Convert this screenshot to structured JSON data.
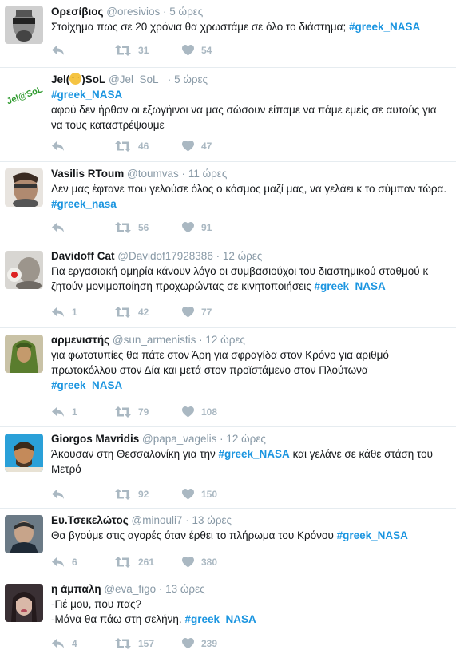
{
  "tweets": [
    {
      "name": "Ορεσίβιος",
      "handle": "@oresivios",
      "time": "5 ώρες",
      "text": "Στοίχημα πως σε 20 χρόνια θα χρωστάμε σε όλο το διάστημα;",
      "hashtag": "#greek_NASA",
      "replies": "",
      "retweets": "31",
      "likes": "54"
    },
    {
      "name_pre": "Jel(",
      "name_post": ")SoL",
      "handle": "@Jel_SoL_",
      "time": "5 ώρες",
      "hashtag": "#greek_NASA",
      "text": "αφού δεν ήρθαν οι εξωγήινοι να μας σώσουν είπαμε να πάμε εμείς σε αυτούς για να τους καταστρέψουμε",
      "avatar_text": "Jel@SoL",
      "replies": "",
      "retweets": "46",
      "likes": "47"
    },
    {
      "name": "Vasilis RToum",
      "handle": "@toumvas",
      "time": "11 ώρες",
      "text": "Δεν μας έφτανε που γελούσε όλος ο κόσμος μαζί μας, να γελάει κ το σύμπαν τώρα.",
      "hashtag": "#greek_nasa",
      "replies": "",
      "retweets": "56",
      "likes": "91"
    },
    {
      "name": "Davidoff Cat",
      "handle": "@Davidof17928386",
      "time": "12 ώρες",
      "text": "Για εργασιακή ομηρία κάνουν λόγο οι συμβασιούχοι του διαστημικού σταθμού κ ζητούν μονιμοποίηση προχωρώντας σε κινητοποιήσεις",
      "hashtag": "#greek_NASA",
      "replies": "1",
      "retweets": "42",
      "likes": "77"
    },
    {
      "name": "αρμενιστής",
      "handle": "@sun_armenistis",
      "time": "12 ώρες",
      "text": "για φωτοτυπίες θα πάτε στον Άρη για σφραγίδα στον Κρόνο για αριθμό πρωτοκόλλου στον Δία και μετά στον προϊστάμενο στον Πλούτωνα",
      "hashtag": "#greek_NASA",
      "replies": "1",
      "retweets": "79",
      "likes": "108"
    },
    {
      "name": "Giorgos Mavridis",
      "handle": "@papa_vagelis",
      "time": "12 ώρες",
      "text_pre": "Άκουσαν στη Θεσσαλονίκη για την",
      "hashtag": "#greek_NASA",
      "text_post": "και γελάνε σε κάθε στάση του Μετρό",
      "replies": "",
      "retweets": "92",
      "likes": "150"
    },
    {
      "name": "Ευ.Τσεκελώτος",
      "handle": "@minouli7",
      "time": "13 ώρες",
      "text": "Θα βγούμε στις αγορές όταν έρθει το πλήρωμα του Κρόνου",
      "hashtag": "#greek_NASA",
      "replies": "6",
      "retweets": "261",
      "likes": "380"
    },
    {
      "name": "η άμπαλη",
      "handle": "@eva_figo",
      "time": "13 ώρες",
      "text_line1": "-Γιέ μου, που πας?",
      "text_line2": "-Μάνα θα πάω στη σελήνη.",
      "hashtag": "#greek_NASA",
      "replies": "4",
      "retweets": "157",
      "likes": "239"
    }
  ],
  "separator": "·",
  "colors": {
    "hashtag": "#1b95e0",
    "meta": "#8899a6",
    "action": "#aab8c2",
    "divider": "#e6ecf0"
  },
  "icons": [
    "reply-icon",
    "retweet-icon",
    "like-icon"
  ]
}
